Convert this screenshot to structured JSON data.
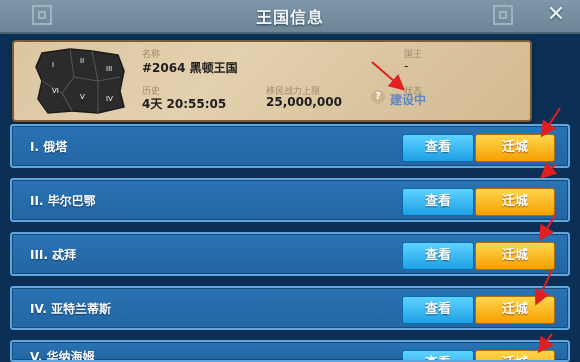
{
  "window": {
    "title": "王国信息"
  },
  "kingdom": {
    "name_label": "名称",
    "name": "#2064 黑顿王国",
    "king_label": "国王",
    "king": "-",
    "history_label": "历史",
    "history": "4天 20:55:05",
    "cap_label": "移民战力上限",
    "cap": "25,000,000",
    "status_label": "状态",
    "status": "建设中",
    "map_regions": [
      "I",
      "II",
      "III",
      "IV",
      "V",
      "VI"
    ]
  },
  "list": {
    "rows": [
      {
        "label": "I. 俄塔",
        "view": "查看",
        "move": "迁城"
      },
      {
        "label": "II. 毕尔巴鄂",
        "view": "查看",
        "move": "迁城"
      },
      {
        "label": "III. 忒拜",
        "view": "查看",
        "move": "迁城"
      },
      {
        "label": "IV. 亚特兰蒂斯",
        "view": "查看",
        "move": "迁城"
      },
      {
        "label": "V. 华纳海姆",
        "view": "查看",
        "move": "迁城"
      }
    ]
  },
  "colors": {
    "accent_blue": "#1ea0e6",
    "accent_gold": "#f5a000",
    "annotation_red": "#e02020"
  }
}
